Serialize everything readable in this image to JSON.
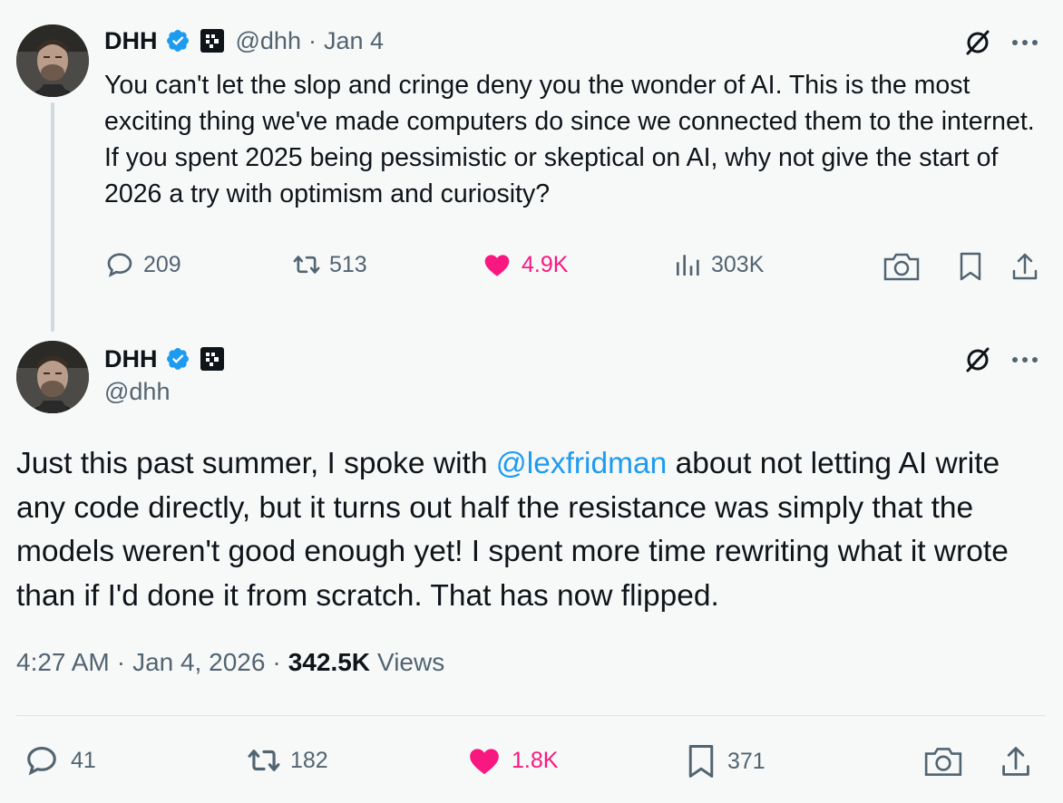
{
  "tweet1": {
    "author_name": "DHH",
    "handle": "@dhh",
    "separator": "·",
    "date": "Jan 4",
    "text": "You can't let the slop and cringe deny you the wonder of AI. This is the most exciting thing we've made computers do since we connected them to the internet. If you spent 2025 being pessimistic or skeptical on AI, why not give the start of 2026 a try with optimism and curiosity?",
    "replies": "209",
    "reposts": "513",
    "likes": "4.9K",
    "views": "303K"
  },
  "tweet2": {
    "author_name": "DHH",
    "handle": "@dhh",
    "text_before": "Just this past summer, I spoke with ",
    "mention": "@lexfridman",
    "text_after": " about not letting AI write any code directly, but it turns out half the resistance was simply that the models weren't good enough yet! I spent more time rewriting what it wrote than if I'd done it from scratch. That has now flipped.",
    "time": "4:27 AM",
    "separator": "·",
    "full_date": "Jan 4, 2026",
    "views_count": "342.5K",
    "views_label": "Views",
    "replies": "41",
    "reposts": "182",
    "likes": "1.8K",
    "bookmarks": "371"
  },
  "icons": [
    "verified-badge-icon",
    "affiliation-badge-icon",
    "grok-icon",
    "more-icon",
    "reply-icon",
    "repost-icon",
    "like-icon",
    "views-icon",
    "camera-icon",
    "bookmark-icon",
    "share-icon"
  ],
  "colors": {
    "text": "#0f1419",
    "secondary": "#536471",
    "link": "#1d9bf0",
    "like": "#f91880",
    "verified": "#1d9bf0"
  }
}
